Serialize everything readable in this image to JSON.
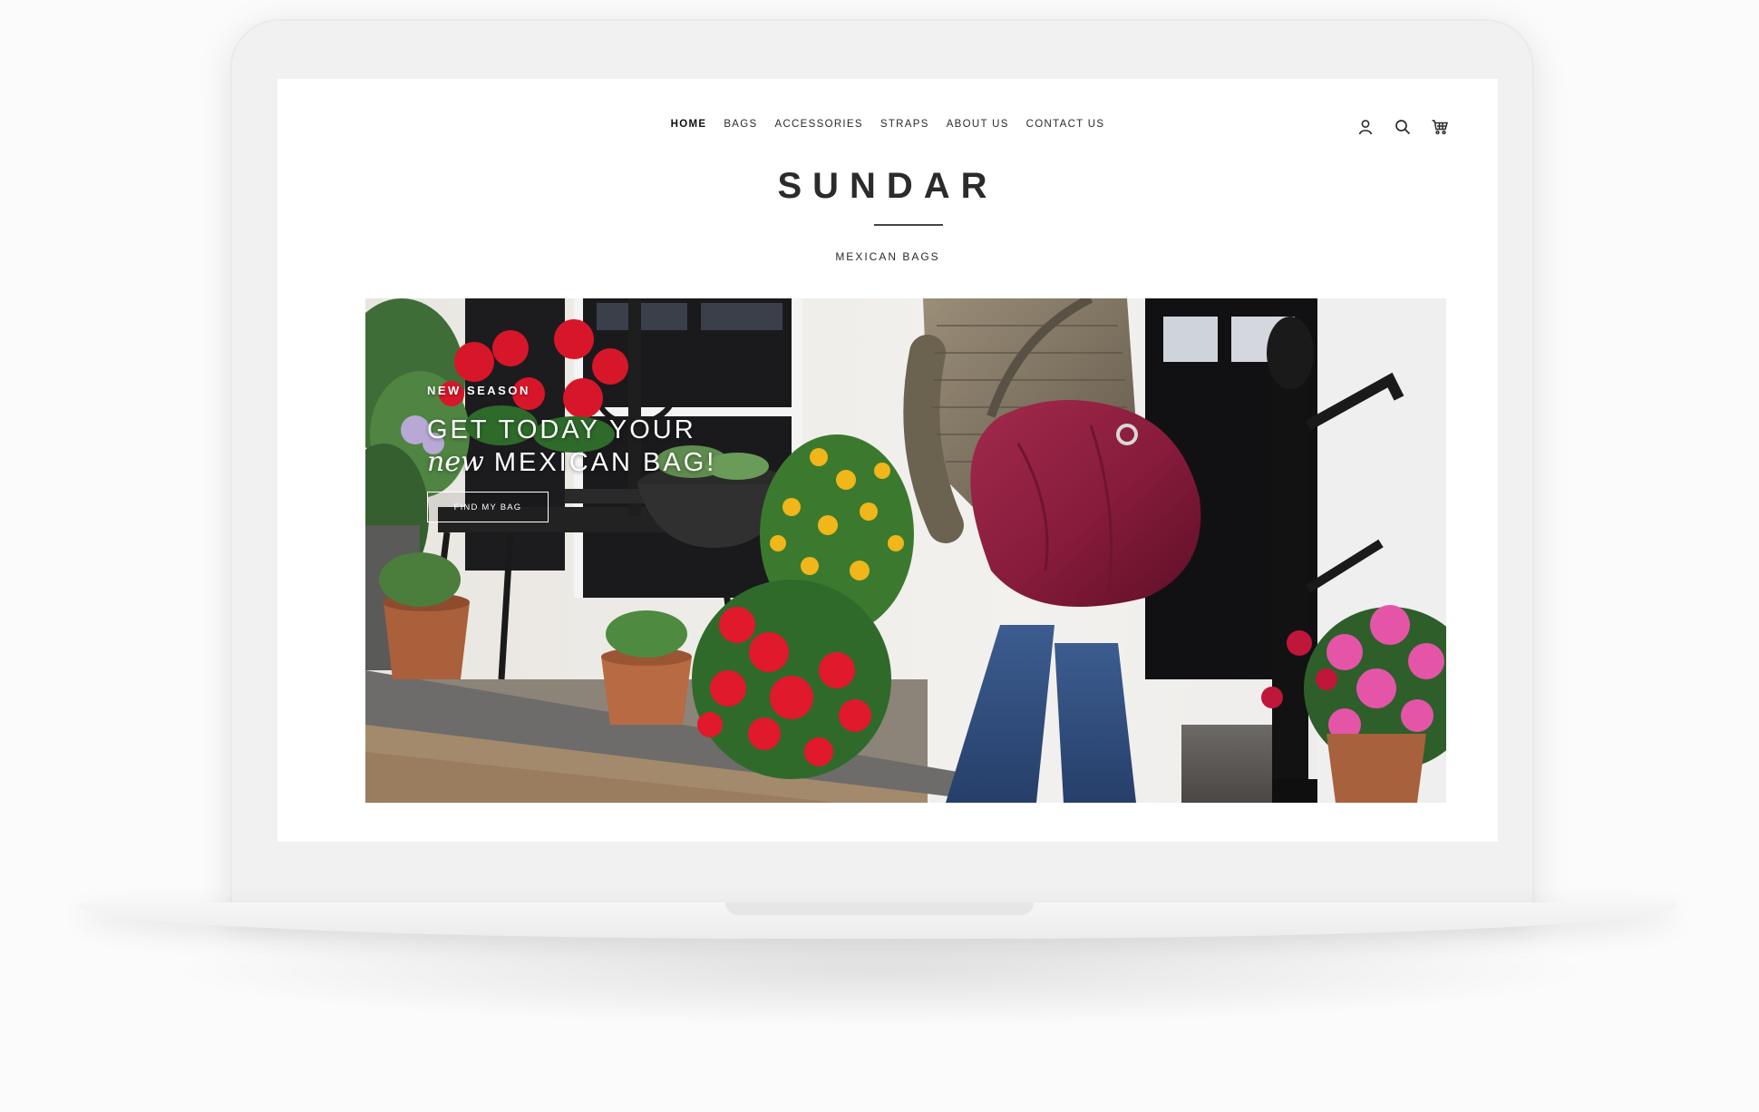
{
  "nav": {
    "items": [
      {
        "label": "HOME",
        "active": true
      },
      {
        "label": "BAGS"
      },
      {
        "label": "ACCESSORIES"
      },
      {
        "label": "STRAPS"
      },
      {
        "label": "ABOUT US"
      },
      {
        "label": "CONTACT US"
      }
    ]
  },
  "header_icons": [
    "account-icon",
    "search-icon",
    "cart-icon"
  ],
  "brand": {
    "name": "SUNDAR",
    "tagline": "MEXICAN BAGS"
  },
  "hero": {
    "eyebrow": "NEW SEASON",
    "headline_line1": "GET TODAY YOUR",
    "headline_script": "new",
    "headline_line2": "MEXICAN BAG!",
    "cta_label": "FIND MY BAG"
  },
  "colors": {
    "bag": "#8a1c3c",
    "jacket": "#7f7460",
    "jeans": "#2f4c7e",
    "text": "#2a2a2a"
  }
}
